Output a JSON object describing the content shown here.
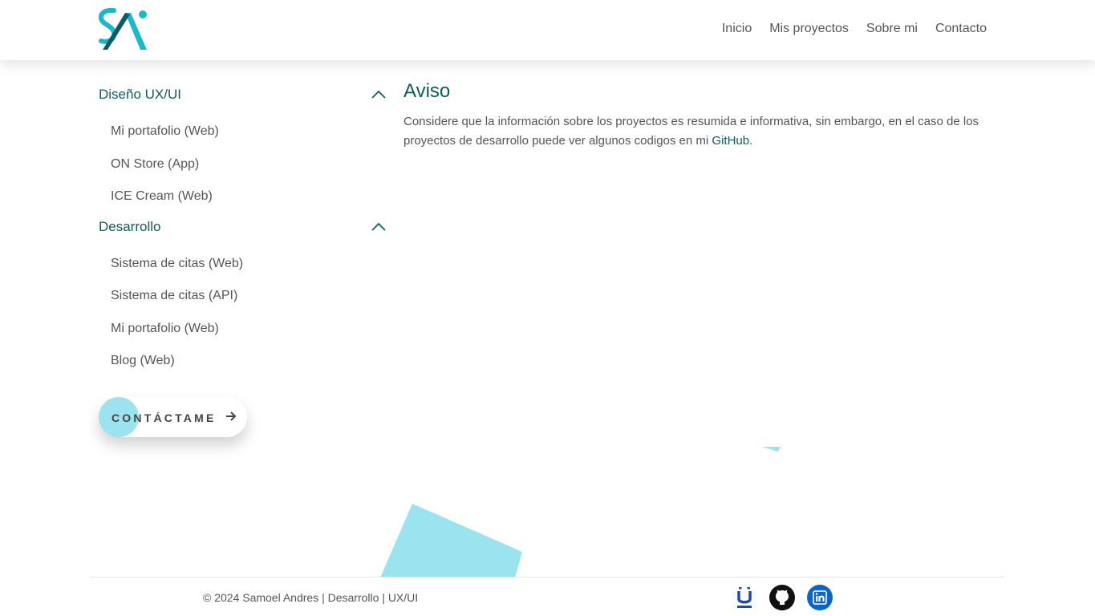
{
  "brand": {
    "logo_text": "SAi",
    "accent": "#1bb8c9",
    "dark": "#0d5c63",
    "light": "#9be3ee"
  },
  "nav": {
    "items": [
      "Inicio",
      "Mis proyectos",
      "Sobre mi",
      "Contacto"
    ]
  },
  "sidebar": {
    "sections": [
      {
        "title": "Diseño UX/UI",
        "items": [
          "Mi portafolio (Web)",
          "ON Store (App)",
          "ICE Cream (Web)"
        ]
      },
      {
        "title": "Desarrollo",
        "items": [
          "Sistema de citas (Web)",
          "Sistema de citas (API)",
          "Mi portafolio (Web)",
          "Blog (Web)"
        ]
      }
    ],
    "cta_label": "CONTÁCTAME"
  },
  "main": {
    "heading": "Aviso",
    "text_before": "Considere que la información sobre los proyectos es resumida e informativa, sin embargo, en el caso de los proyectos de desarrollo puede ver algunos codigos en mi ",
    "link": "GitHub",
    "text_after": "."
  },
  "footer": {
    "copyright": "© 2024 Samoel Andres | Desarrollo | UX/UI",
    "social": [
      "u-icon",
      "github-icon",
      "linkedin-icon"
    ]
  }
}
